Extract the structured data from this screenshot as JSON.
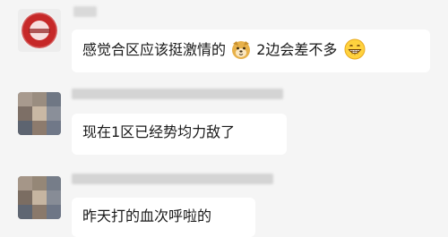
{
  "messages": [
    {
      "sender_name": "",
      "text_before_emoji": "感觉合区应该挺激情的",
      "emoji_1": "doge-emoji",
      "text_after_emoji": " 2边会差不多",
      "emoji_2": "grin-emoji"
    },
    {
      "sender_name": "",
      "text": "现在1区已经势均力敌了"
    },
    {
      "sender_name": "",
      "text": "昨天打的血次呼啦的"
    }
  ]
}
